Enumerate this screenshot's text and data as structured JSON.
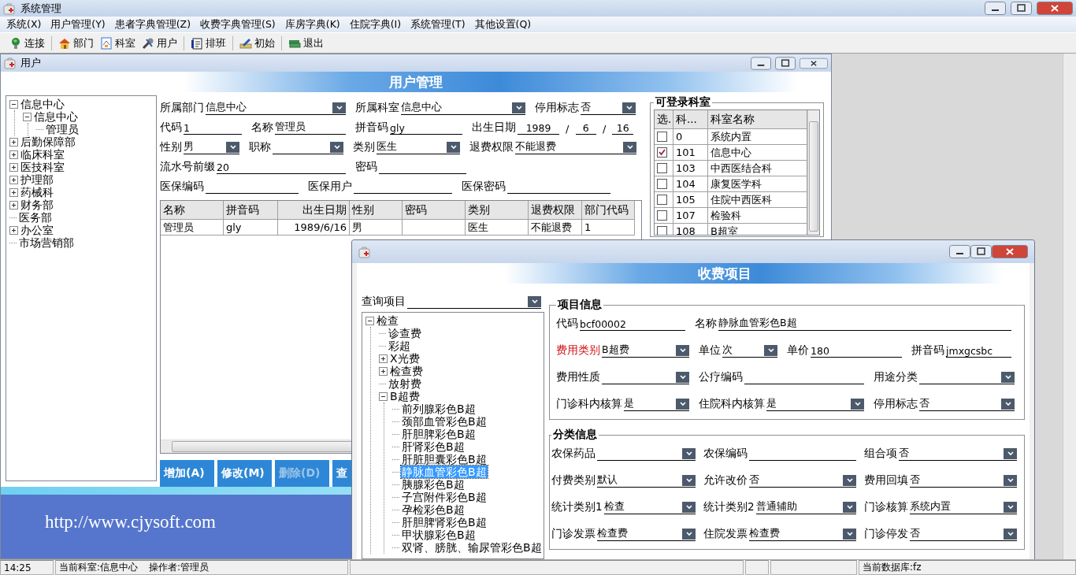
{
  "app": {
    "title": "系统管理"
  },
  "menu": [
    "系统(X)",
    "用户管理(Y)",
    "患者字典管理(Z)",
    "收费字典管理(S)",
    "库房字典(K)",
    "住院字典(I)",
    "系统管理(T)",
    "其他设置(Q)"
  ],
  "toolbar": [
    [
      "连接"
    ],
    [
      "部门",
      "科室",
      "用户"
    ],
    [
      "排班"
    ],
    [
      "初始"
    ],
    [
      "退出"
    ]
  ],
  "user_window": {
    "title": "用户",
    "header": "用户管理",
    "dept_tree": [
      {
        "label": "信息中心",
        "expanded": true,
        "children": [
          {
            "label": "信息中心",
            "expanded": true,
            "children": [
              {
                "label": "管理员"
              }
            ]
          }
        ]
      },
      {
        "label": "后勤保障部",
        "expanded": false
      },
      {
        "label": "临床科室",
        "expanded": false
      },
      {
        "label": "医技科室",
        "expanded": false
      },
      {
        "label": "护理部",
        "expanded": false
      },
      {
        "label": "药械科",
        "expanded": false
      },
      {
        "label": "财务部",
        "expanded": false
      },
      {
        "label": "医务部"
      },
      {
        "label": "办公室",
        "expanded": false
      },
      {
        "label": "市场营销部"
      }
    ],
    "form": [
      [
        {
          "kind": "combo",
          "label": "所属部门",
          "value": "信息中心"
        },
        {
          "kind": "combo",
          "label": "所属科室",
          "value": "信息中心"
        },
        {
          "kind": "combo",
          "label": "停用标志",
          "value": "否"
        }
      ],
      [
        {
          "kind": "text",
          "label": "代码",
          "value": "1"
        },
        {
          "kind": "text",
          "label": "名称",
          "value": "管理员"
        },
        {
          "kind": "text",
          "label": "拼音码",
          "value": "gly"
        },
        {
          "kind": "date",
          "label": "出生日期",
          "parts": [
            "1989",
            "6",
            "16"
          ],
          "separators": [
            "/",
            "/"
          ]
        }
      ],
      [
        {
          "kind": "combo",
          "label": "性别",
          "value": "男"
        },
        {
          "kind": "combo",
          "label": "职称"
        },
        {
          "kind": "combo",
          "label": "类别",
          "value": "医生"
        },
        {
          "kind": "combo",
          "label": "退费权限",
          "value": "不能退费"
        }
      ],
      [
        {
          "kind": "text",
          "label": "流水号前缀",
          "value": "20"
        },
        {
          "kind": "text",
          "label": "密码"
        }
      ],
      [
        {
          "kind": "text",
          "label": "医保编码"
        },
        {
          "kind": "text",
          "label": "医保用户"
        },
        {
          "kind": "text",
          "label": "医保密码"
        }
      ]
    ],
    "table": {
      "columns": [
        "名称",
        "拼音码",
        "出生日期",
        "性别",
        "密码",
        "类别",
        "退费权限",
        "部门代码"
      ],
      "rows": [
        [
          "管理员",
          "gly",
          "1989/6/16",
          "男",
          null,
          "医生",
          "不能退费",
          "1"
        ]
      ]
    },
    "buttons": [
      {
        "label": "增加(A)",
        "disabled": false
      },
      {
        "label": "修改(M)",
        "disabled": false
      },
      {
        "label": "删除(D)",
        "disabled": true
      },
      {
        "label": "查",
        "disabled": false
      }
    ],
    "login_depts": {
      "title": "可登录科室",
      "columns": [
        "选.",
        "科...",
        "科室名称"
      ],
      "rows": [
        {
          "checked": false,
          "code": "0",
          "name": "系统内置"
        },
        {
          "checked": true,
          "code": "101",
          "name": "信息中心"
        },
        {
          "checked": false,
          "code": "103",
          "name": "中西医结合科"
        },
        {
          "checked": false,
          "code": "104",
          "name": "康复医学科"
        },
        {
          "checked": false,
          "code": "105",
          "name": "住院中西医科"
        },
        {
          "checked": false,
          "code": "107",
          "name": "检验科"
        },
        {
          "checked": false,
          "code": "108",
          "name": "B超室"
        }
      ]
    },
    "banner": {
      "url": "http://www.cjysoft.com"
    }
  },
  "charge_window": {
    "header": "收费项目",
    "query": {
      "label": "查询项目"
    },
    "tree": [
      {
        "label": "检查",
        "expanded": true,
        "selected": false,
        "children": [
          {
            "label": "诊查费",
            "selected": false
          },
          {
            "label": "彩超",
            "selected": false
          },
          {
            "label": "X光费",
            "expanded": false,
            "selected": false
          },
          {
            "label": "检查费",
            "expanded": false,
            "selected": false
          },
          {
            "label": "放射费",
            "selected": false
          },
          {
            "label": "B超费",
            "expanded": true,
            "selected": false,
            "children": [
              {
                "label": "前列腺彩色B超",
                "selected": false
              },
              {
                "label": "颈部血管彩色B超",
                "selected": false
              },
              {
                "label": "肝胆脾彩色B超",
                "selected": false
              },
              {
                "label": "肝肾彩色B超",
                "selected": false
              },
              {
                "label": "肝脏胆囊彩色B超",
                "selected": false
              },
              {
                "label": "静脉血管彩色B超",
                "selected": true
              },
              {
                "label": "胰腺彩色B超",
                "selected": false
              },
              {
                "label": "子宫附件彩色B超",
                "selected": false
              },
              {
                "label": "孕检彩色B超",
                "selected": false
              },
              {
                "label": "肝胆脾肾彩色B超",
                "selected": false
              },
              {
                "label": "甲状腺彩色B超",
                "selected": false
              },
              {
                "label": "双肾、膀胱、输尿管彩色B超",
                "selected": false
              }
            ]
          }
        ]
      }
    ],
    "groups": [
      {
        "title": "项目信息",
        "rows": [
          [
            {
              "kind": "text",
              "label": "代码",
              "value": "bcf00002",
              "required": false
            },
            {
              "kind": "text",
              "label": "名称",
              "value": "静脉血管彩色B超",
              "required": false
            }
          ],
          [
            {
              "kind": "combo",
              "label": "费用类别",
              "value": "B超费",
              "required": true
            },
            {
              "kind": "combo",
              "label": "单位",
              "value": "次",
              "required": false
            },
            {
              "kind": "text",
              "label": "单价",
              "value": "180",
              "required": false
            },
            {
              "kind": "text",
              "label": "拼音码",
              "value": "jmxgcsbc",
              "required": false
            }
          ],
          [
            {
              "kind": "combo",
              "label": "费用性质",
              "required": false
            },
            {
              "kind": "text",
              "label": "公疗编码",
              "required": false
            },
            {
              "kind": "combo",
              "label": "用途分类",
              "required": false
            }
          ],
          [
            {
              "kind": "combo",
              "label": "门诊科内核算",
              "value": "是",
              "required": false
            },
            {
              "kind": "combo",
              "label": "住院科内核算",
              "value": "是",
              "required": false
            },
            {
              "kind": "combo",
              "label": "停用标志",
              "value": "否",
              "required": false
            }
          ]
        ]
      },
      {
        "title": "分类信息",
        "rows": [
          [
            {
              "kind": "combo",
              "label": "农保药品"
            },
            {
              "kind": "text",
              "label": "农保编码"
            },
            {
              "kind": "combo",
              "label": "组合项",
              "value": "否"
            }
          ],
          [
            {
              "kind": "combo",
              "label": "付费类别",
              "value": "默认"
            },
            {
              "kind": "combo",
              "label": "允许改价",
              "value": "否"
            },
            {
              "kind": "combo",
              "label": "费用回填",
              "value": "否"
            }
          ],
          [
            {
              "kind": "combo",
              "label": "统计类别1",
              "value": "检查"
            },
            {
              "kind": "combo",
              "label": "统计类别2",
              "value": "普通辅助"
            },
            {
              "kind": "combo",
              "label": "门诊核算",
              "value": "系统内置"
            }
          ],
          [
            {
              "kind": "combo",
              "label": "门诊发票",
              "value": "检查费"
            },
            {
              "kind": "combo",
              "label": "住院发票",
              "value": "检查费"
            },
            {
              "kind": "combo",
              "label": "门诊停发",
              "value": "否"
            }
          ]
        ]
      }
    ]
  },
  "status_bar": {
    "time": "14:25",
    "context": [
      "当前科室:信息中心",
      "操作者:管理员"
    ],
    "database": "当前数据库:fz"
  }
}
